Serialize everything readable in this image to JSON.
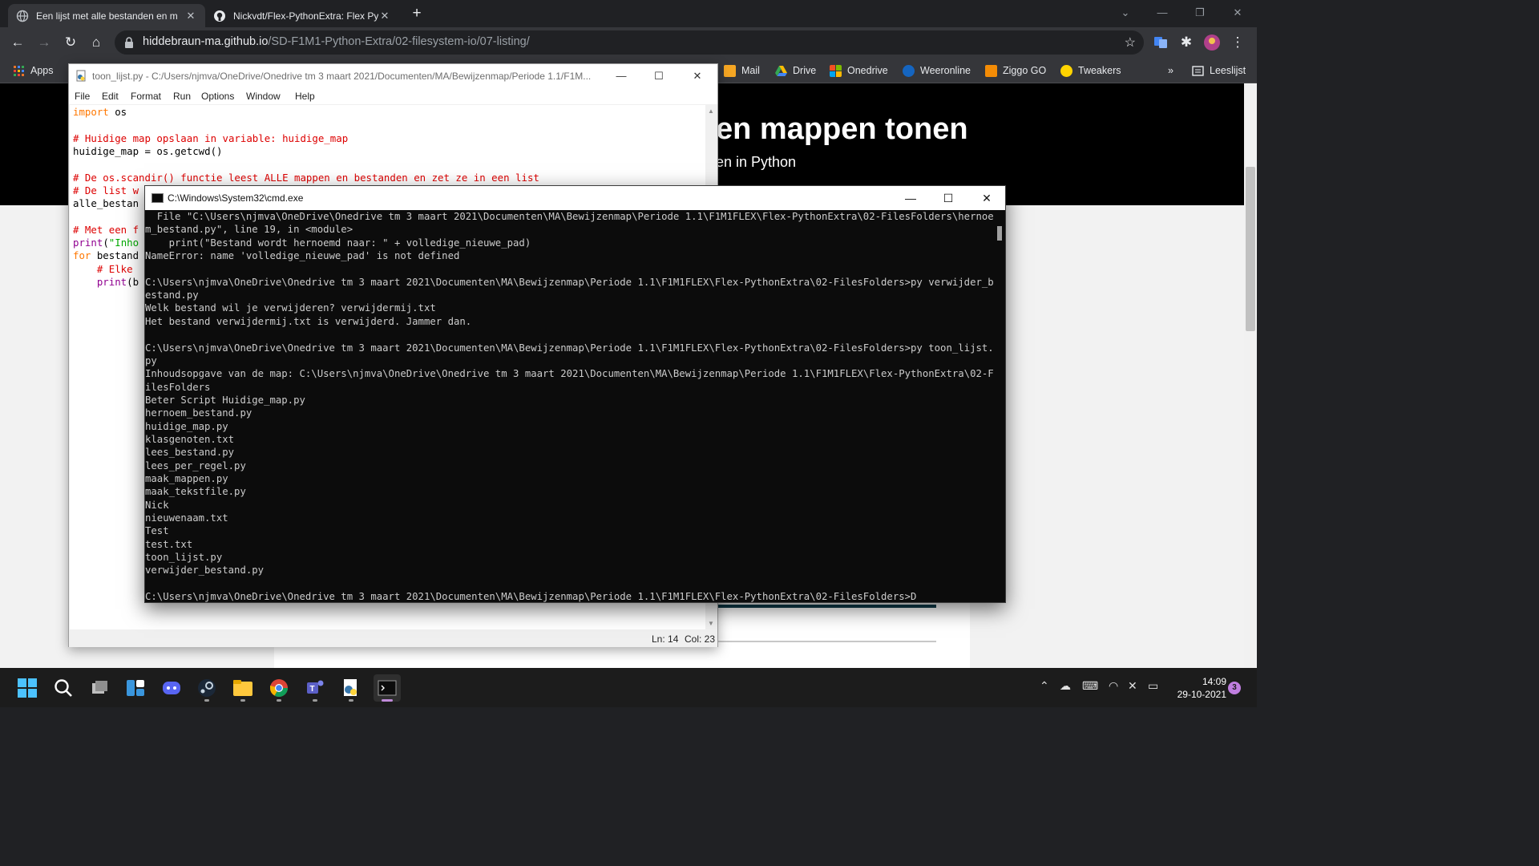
{
  "browser": {
    "tabs": [
      {
        "title": "Een lijst met alle bestanden en m",
        "close": "✕"
      },
      {
        "title": "Nickvdt/Flex-PythonExtra: Flex Py",
        "close": "✕"
      }
    ],
    "new_tab": "+",
    "url_host": "hiddebraun-ma.github.io",
    "url_path": "/SD-F1M1-Python-Extra/02-filesystem-io/07-listing/",
    "bookmarks": [
      "Apps",
      "Mail",
      "Drive",
      "Onedrive",
      "Weeronline",
      "Ziggo GO",
      "Tweakers",
      "Leeslijst"
    ],
    "bookmarks_more": "»"
  },
  "page": {
    "title_fragment": "en mappen tonen",
    "subtitle_fragment": "en in Python"
  },
  "idle": {
    "title": "toon_lijst.py - C:/Users/njmva/OneDrive/Onedrive tm 3 maart 2021/Documenten/MA/Bewijzenmap/Periode 1.1/F1M...",
    "menu": [
      "File",
      "Edit",
      "Format",
      "Run",
      "Options",
      "Window",
      "Help"
    ],
    "code": [
      {
        "t": "import os",
        "c": "kw"
      },
      {
        "t": "",
        "c": ""
      },
      {
        "t": "# Huidige map opslaan in variable: huidige_map",
        "c": "cm"
      },
      {
        "t": "huidige_map = os.getcwd()",
        "c": ""
      },
      {
        "t": "",
        "c": ""
      },
      {
        "t": "# De os.scandir() functie leest ALLE mappen en bestanden en zet ze in een list",
        "c": "cm"
      },
      {
        "t": "# De list w",
        "c": "cm"
      },
      {
        "t": "alle_bestan",
        "c": ""
      },
      {
        "t": "",
        "c": ""
      },
      {
        "t": "# Met een f",
        "c": "cm"
      },
      {
        "t": "print(\"Inho",
        "c": "pr"
      },
      {
        "t": "for bestand",
        "c": "for"
      },
      {
        "t": "    # Elke",
        "c": "cm"
      },
      {
        "t": "    print(b",
        "c": "pr"
      }
    ],
    "status_ln": "Ln: 14",
    "status_col": "Col: 23"
  },
  "cmd": {
    "title": "C:\\Windows\\System32\\cmd.exe",
    "lines": [
      "  File \"C:\\Users\\njmva\\OneDrive\\Onedrive tm 3 maart 2021\\Documenten\\MA\\Bewijzenmap\\Periode 1.1\\F1M1FLEX\\Flex-PythonExtra\\02-FilesFolders\\hernoe",
      "m_bestand.py\", line 19, in <module>",
      "    print(\"Bestand wordt hernoemd naar: \" + volledige_nieuwe_pad)",
      "NameError: name 'volledige_nieuwe_pad' is not defined",
      "",
      "C:\\Users\\njmva\\OneDrive\\Onedrive tm 3 maart 2021\\Documenten\\MA\\Bewijzenmap\\Periode 1.1\\F1M1FLEX\\Flex-PythonExtra\\02-FilesFolders>py verwijder_b",
      "estand.py",
      "Welk bestand wil je verwijderen? verwijdermij.txt",
      "Het bestand verwijdermij.txt is verwijderd. Jammer dan.",
      "",
      "C:\\Users\\njmva\\OneDrive\\Onedrive tm 3 maart 2021\\Documenten\\MA\\Bewijzenmap\\Periode 1.1\\F1M1FLEX\\Flex-PythonExtra\\02-FilesFolders>py toon_lijst.",
      "py",
      "Inhoudsopgave van de map: C:\\Users\\njmva\\OneDrive\\Onedrive tm 3 maart 2021\\Documenten\\MA\\Bewijzenmap\\Periode 1.1\\F1M1FLEX\\Flex-PythonExtra\\02-F",
      "ilesFolders",
      "Beter Script Huidige_map.py",
      "hernoem_bestand.py",
      "huidige_map.py",
      "klasgenoten.txt",
      "lees_bestand.py",
      "lees_per_regel.py",
      "maak_mappen.py",
      "maak_tekstfile.py",
      "Nick",
      "nieuwenaam.txt",
      "Test",
      "test.txt",
      "toon_lijst.py",
      "verwijder_bestand.py",
      "",
      "C:\\Users\\njmva\\OneDrive\\Onedrive tm 3 maart 2021\\Documenten\\MA\\Bewijzenmap\\Periode 1.1\\F1M1FLEX\\Flex-PythonExtra\\02-FilesFolders>D"
    ]
  },
  "taskbar": {
    "apps": [
      "start-icon",
      "search-icon",
      "task-view-icon",
      "widgets-icon",
      "discord-icon",
      "steam-icon",
      "file-explorer-icon",
      "chrome-icon",
      "teams-icon",
      "python-idle-icon",
      "terminal-icon"
    ],
    "time": "14:09",
    "date": "29-10-2021",
    "notification_count": "3"
  },
  "colors": {
    "idle_keyword": "#ff7700",
    "idle_comment": "#dd0000",
    "idle_string": "#00aa00",
    "idle_builtin": "#900090"
  }
}
